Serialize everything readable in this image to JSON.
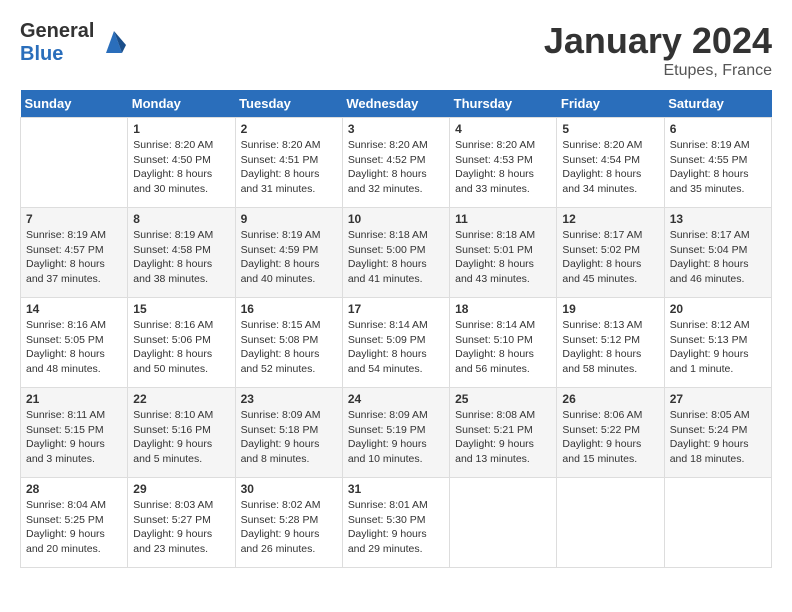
{
  "header": {
    "logo_general": "General",
    "logo_blue": "Blue",
    "title": "January 2024",
    "location": "Etupes, France"
  },
  "calendar": {
    "days_of_week": [
      "Sunday",
      "Monday",
      "Tuesday",
      "Wednesday",
      "Thursday",
      "Friday",
      "Saturday"
    ],
    "weeks": [
      [
        {
          "day": "",
          "sunrise": "",
          "sunset": "",
          "daylight": ""
        },
        {
          "day": "1",
          "sunrise": "Sunrise: 8:20 AM",
          "sunset": "Sunset: 4:50 PM",
          "daylight": "Daylight: 8 hours and 30 minutes."
        },
        {
          "day": "2",
          "sunrise": "Sunrise: 8:20 AM",
          "sunset": "Sunset: 4:51 PM",
          "daylight": "Daylight: 8 hours and 31 minutes."
        },
        {
          "day": "3",
          "sunrise": "Sunrise: 8:20 AM",
          "sunset": "Sunset: 4:52 PM",
          "daylight": "Daylight: 8 hours and 32 minutes."
        },
        {
          "day": "4",
          "sunrise": "Sunrise: 8:20 AM",
          "sunset": "Sunset: 4:53 PM",
          "daylight": "Daylight: 8 hours and 33 minutes."
        },
        {
          "day": "5",
          "sunrise": "Sunrise: 8:20 AM",
          "sunset": "Sunset: 4:54 PM",
          "daylight": "Daylight: 8 hours and 34 minutes."
        },
        {
          "day": "6",
          "sunrise": "Sunrise: 8:19 AM",
          "sunset": "Sunset: 4:55 PM",
          "daylight": "Daylight: 8 hours and 35 minutes."
        }
      ],
      [
        {
          "day": "7",
          "sunrise": "Sunrise: 8:19 AM",
          "sunset": "Sunset: 4:57 PM",
          "daylight": "Daylight: 8 hours and 37 minutes."
        },
        {
          "day": "8",
          "sunrise": "Sunrise: 8:19 AM",
          "sunset": "Sunset: 4:58 PM",
          "daylight": "Daylight: 8 hours and 38 minutes."
        },
        {
          "day": "9",
          "sunrise": "Sunrise: 8:19 AM",
          "sunset": "Sunset: 4:59 PM",
          "daylight": "Daylight: 8 hours and 40 minutes."
        },
        {
          "day": "10",
          "sunrise": "Sunrise: 8:18 AM",
          "sunset": "Sunset: 5:00 PM",
          "daylight": "Daylight: 8 hours and 41 minutes."
        },
        {
          "day": "11",
          "sunrise": "Sunrise: 8:18 AM",
          "sunset": "Sunset: 5:01 PM",
          "daylight": "Daylight: 8 hours and 43 minutes."
        },
        {
          "day": "12",
          "sunrise": "Sunrise: 8:17 AM",
          "sunset": "Sunset: 5:02 PM",
          "daylight": "Daylight: 8 hours and 45 minutes."
        },
        {
          "day": "13",
          "sunrise": "Sunrise: 8:17 AM",
          "sunset": "Sunset: 5:04 PM",
          "daylight": "Daylight: 8 hours and 46 minutes."
        }
      ],
      [
        {
          "day": "14",
          "sunrise": "Sunrise: 8:16 AM",
          "sunset": "Sunset: 5:05 PM",
          "daylight": "Daylight: 8 hours and 48 minutes."
        },
        {
          "day": "15",
          "sunrise": "Sunrise: 8:16 AM",
          "sunset": "Sunset: 5:06 PM",
          "daylight": "Daylight: 8 hours and 50 minutes."
        },
        {
          "day": "16",
          "sunrise": "Sunrise: 8:15 AM",
          "sunset": "Sunset: 5:08 PM",
          "daylight": "Daylight: 8 hours and 52 minutes."
        },
        {
          "day": "17",
          "sunrise": "Sunrise: 8:14 AM",
          "sunset": "Sunset: 5:09 PM",
          "daylight": "Daylight: 8 hours and 54 minutes."
        },
        {
          "day": "18",
          "sunrise": "Sunrise: 8:14 AM",
          "sunset": "Sunset: 5:10 PM",
          "daylight": "Daylight: 8 hours and 56 minutes."
        },
        {
          "day": "19",
          "sunrise": "Sunrise: 8:13 AM",
          "sunset": "Sunset: 5:12 PM",
          "daylight": "Daylight: 8 hours and 58 minutes."
        },
        {
          "day": "20",
          "sunrise": "Sunrise: 8:12 AM",
          "sunset": "Sunset: 5:13 PM",
          "daylight": "Daylight: 9 hours and 1 minute."
        }
      ],
      [
        {
          "day": "21",
          "sunrise": "Sunrise: 8:11 AM",
          "sunset": "Sunset: 5:15 PM",
          "daylight": "Daylight: 9 hours and 3 minutes."
        },
        {
          "day": "22",
          "sunrise": "Sunrise: 8:10 AM",
          "sunset": "Sunset: 5:16 PM",
          "daylight": "Daylight: 9 hours and 5 minutes."
        },
        {
          "day": "23",
          "sunrise": "Sunrise: 8:09 AM",
          "sunset": "Sunset: 5:18 PM",
          "daylight": "Daylight: 9 hours and 8 minutes."
        },
        {
          "day": "24",
          "sunrise": "Sunrise: 8:09 AM",
          "sunset": "Sunset: 5:19 PM",
          "daylight": "Daylight: 9 hours and 10 minutes."
        },
        {
          "day": "25",
          "sunrise": "Sunrise: 8:08 AM",
          "sunset": "Sunset: 5:21 PM",
          "daylight": "Daylight: 9 hours and 13 minutes."
        },
        {
          "day": "26",
          "sunrise": "Sunrise: 8:06 AM",
          "sunset": "Sunset: 5:22 PM",
          "daylight": "Daylight: 9 hours and 15 minutes."
        },
        {
          "day": "27",
          "sunrise": "Sunrise: 8:05 AM",
          "sunset": "Sunset: 5:24 PM",
          "daylight": "Daylight: 9 hours and 18 minutes."
        }
      ],
      [
        {
          "day": "28",
          "sunrise": "Sunrise: 8:04 AM",
          "sunset": "Sunset: 5:25 PM",
          "daylight": "Daylight: 9 hours and 20 minutes."
        },
        {
          "day": "29",
          "sunrise": "Sunrise: 8:03 AM",
          "sunset": "Sunset: 5:27 PM",
          "daylight": "Daylight: 9 hours and 23 minutes."
        },
        {
          "day": "30",
          "sunrise": "Sunrise: 8:02 AM",
          "sunset": "Sunset: 5:28 PM",
          "daylight": "Daylight: 9 hours and 26 minutes."
        },
        {
          "day": "31",
          "sunrise": "Sunrise: 8:01 AM",
          "sunset": "Sunset: 5:30 PM",
          "daylight": "Daylight: 9 hours and 29 minutes."
        },
        {
          "day": "",
          "sunrise": "",
          "sunset": "",
          "daylight": ""
        },
        {
          "day": "",
          "sunrise": "",
          "sunset": "",
          "daylight": ""
        },
        {
          "day": "",
          "sunrise": "",
          "sunset": "",
          "daylight": ""
        }
      ]
    ]
  }
}
